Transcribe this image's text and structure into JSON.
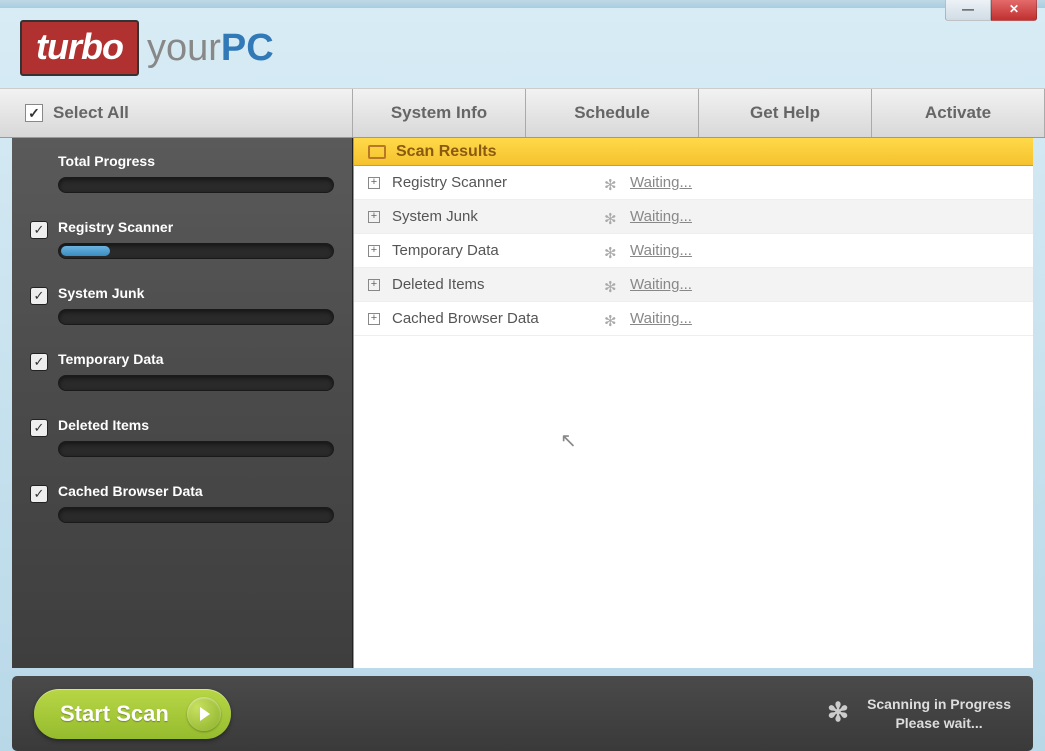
{
  "logo": {
    "turbo": "turbo",
    "your": "your",
    "pc": "PC"
  },
  "tabs": {
    "select_all": "Select All",
    "system_info": "System Info",
    "schedule": "Schedule",
    "get_help": "Get Help",
    "activate": "Activate"
  },
  "sidebar": {
    "total_progress": "Total Progress",
    "items": [
      {
        "label": "Registry Scanner",
        "progress": 18
      },
      {
        "label": "System Junk",
        "progress": 0
      },
      {
        "label": "Temporary Data",
        "progress": 0
      },
      {
        "label": "Deleted Items",
        "progress": 0
      },
      {
        "label": "Cached Browser Data",
        "progress": 0
      }
    ]
  },
  "results": {
    "header": "Scan Results",
    "rows": [
      {
        "name": "Registry Scanner",
        "status": "Waiting..."
      },
      {
        "name": "System Junk",
        "status": "Waiting..."
      },
      {
        "name": "Temporary Data",
        "status": "Waiting..."
      },
      {
        "name": "Deleted Items",
        "status": "Waiting..."
      },
      {
        "name": "Cached Browser Data",
        "status": "Waiting..."
      }
    ]
  },
  "footer": {
    "start_scan": "Start Scan",
    "status_line1": "Scanning in Progress",
    "status_line2": "Please wait..."
  }
}
